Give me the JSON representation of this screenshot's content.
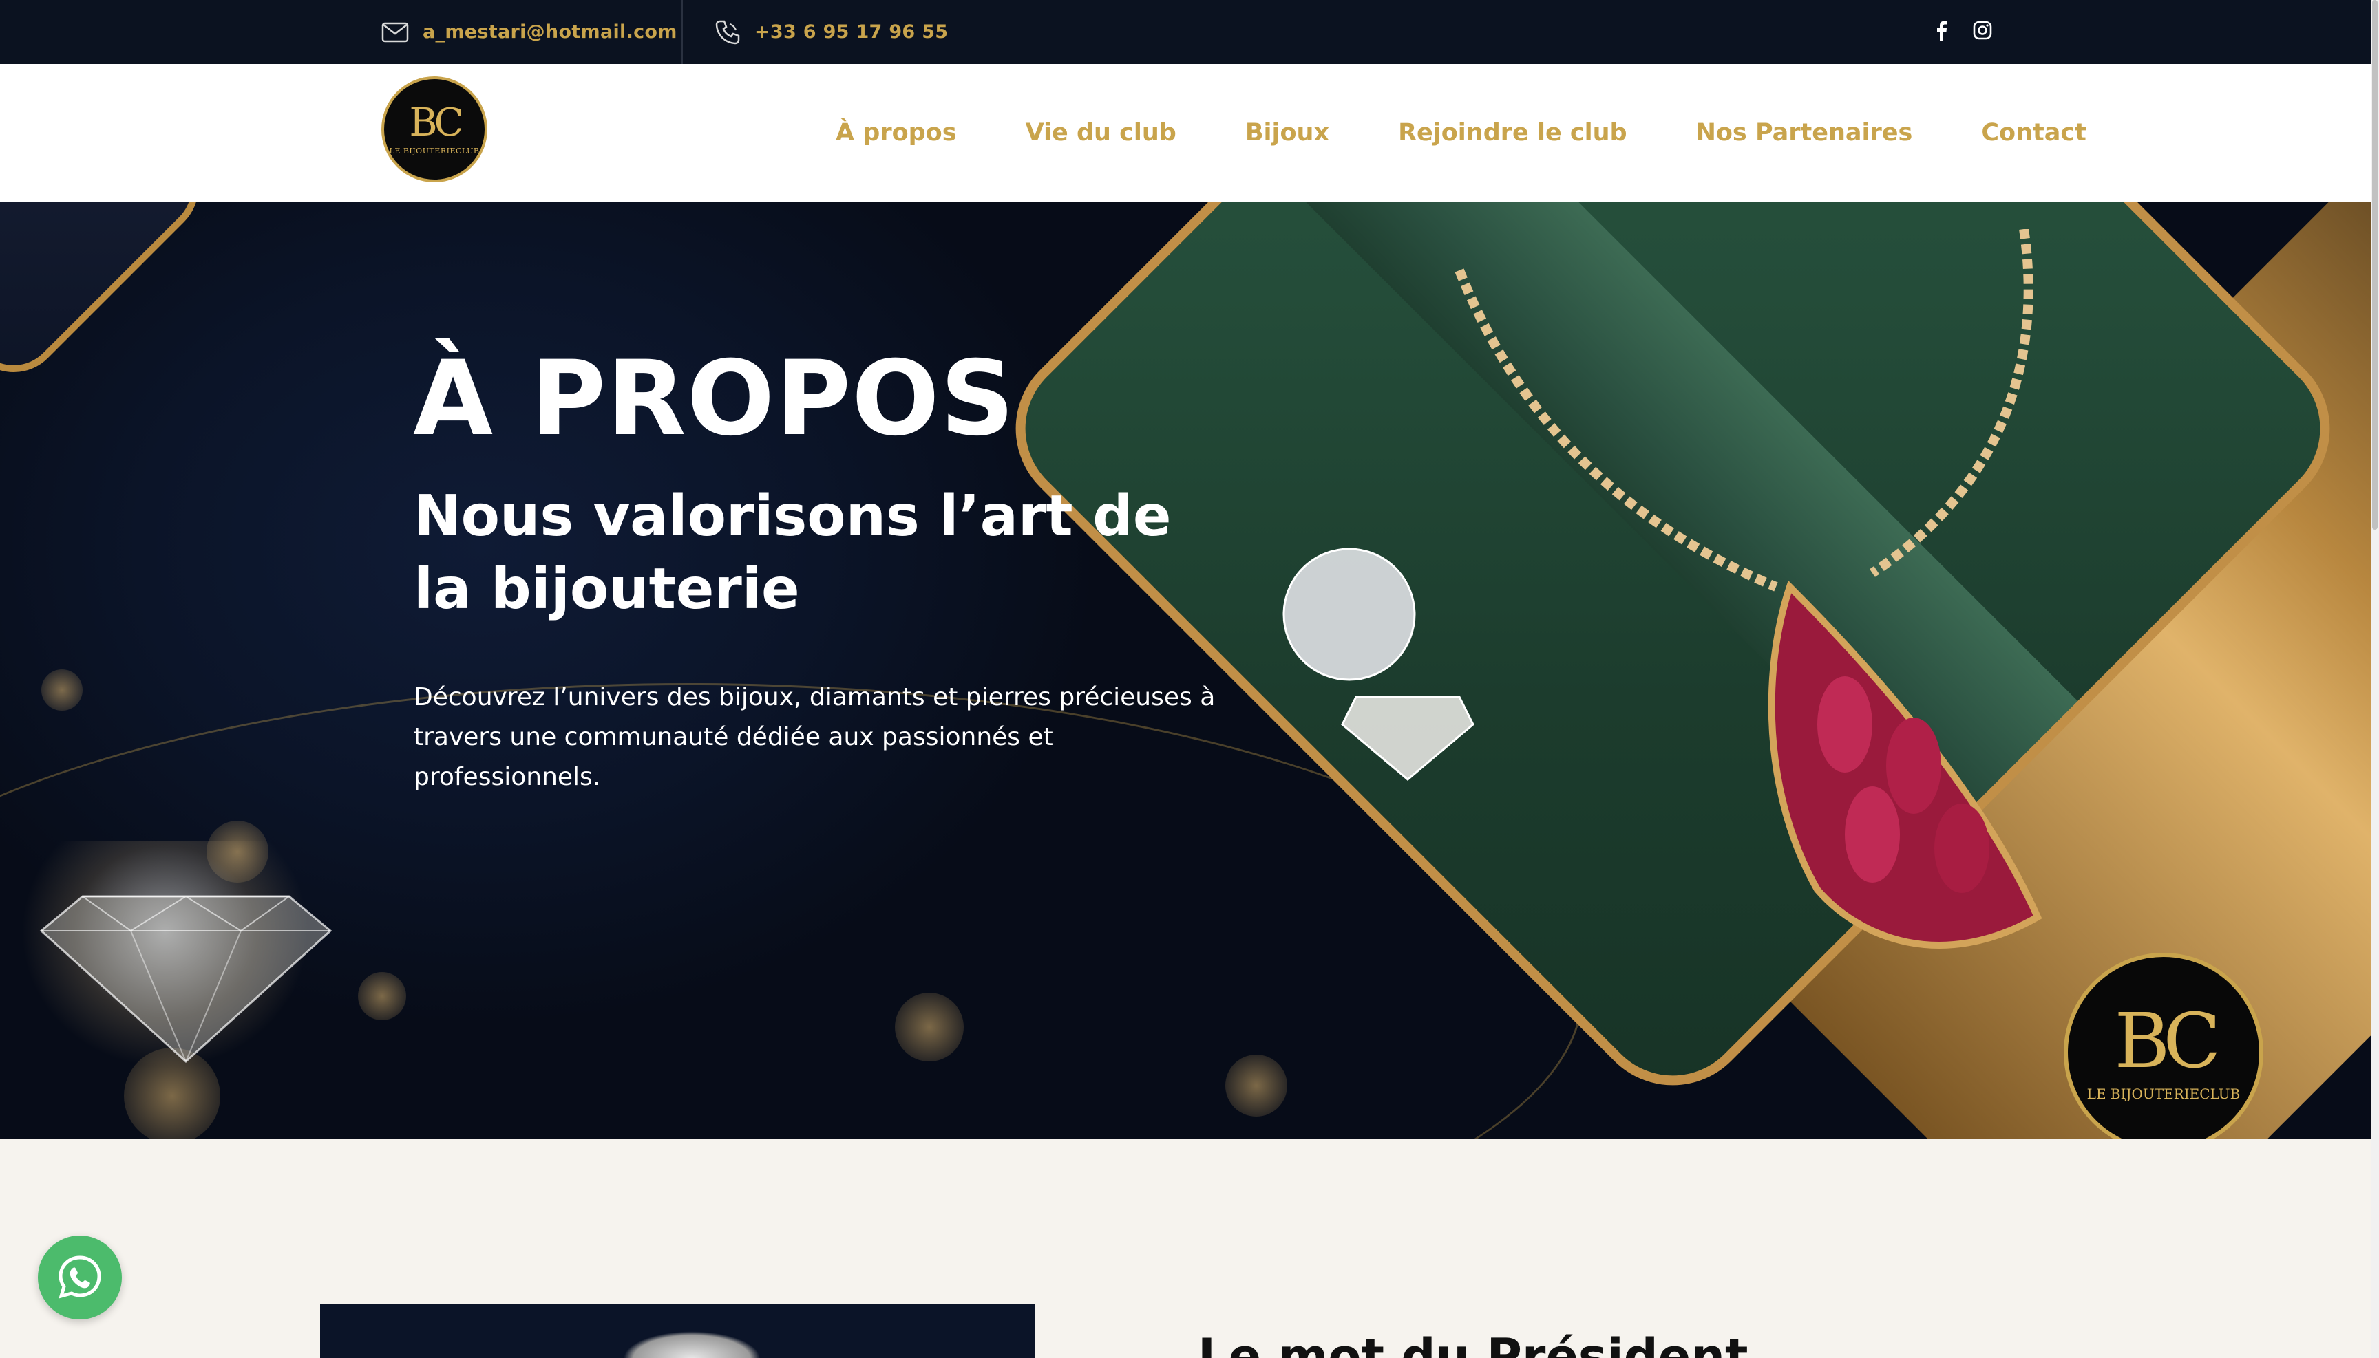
{
  "topbar": {
    "email": "a_mestari@hotmail.com",
    "phone": "+33 6 95 17 96 55",
    "email_icon": "mail-icon",
    "phone_icon": "phone-icon",
    "social": [
      "facebook-icon",
      "instagram-icon"
    ]
  },
  "header": {
    "logo": {
      "monogram": "BC",
      "name": "LE BIJOUTERIECLUB"
    },
    "nav": [
      "À propos",
      "Vie du club",
      "Bijoux",
      "Rejoindre le club",
      "Nos Partenaires",
      "Contact"
    ]
  },
  "hero": {
    "title": "À PROPOS",
    "subtitle": "Nous valorisons l’art de la bijouterie",
    "text": "Découvrez l’univers des bijoux, diamants et pierres précieuses à travers une communauté dédiée aux passionnés et professionnels.",
    "badge": {
      "monogram": "BC",
      "name": "LE BIJOUTERIECLUB"
    }
  },
  "section": {
    "title": "Le mot du Président"
  },
  "colors": {
    "gold": "#c9a44c",
    "dark_navy": "#0b1220",
    "cream": "#f6f3ee",
    "whatsapp_green": "#4cbb6c"
  },
  "floating": {
    "whatsapp_icon": "whatsapp-icon"
  }
}
